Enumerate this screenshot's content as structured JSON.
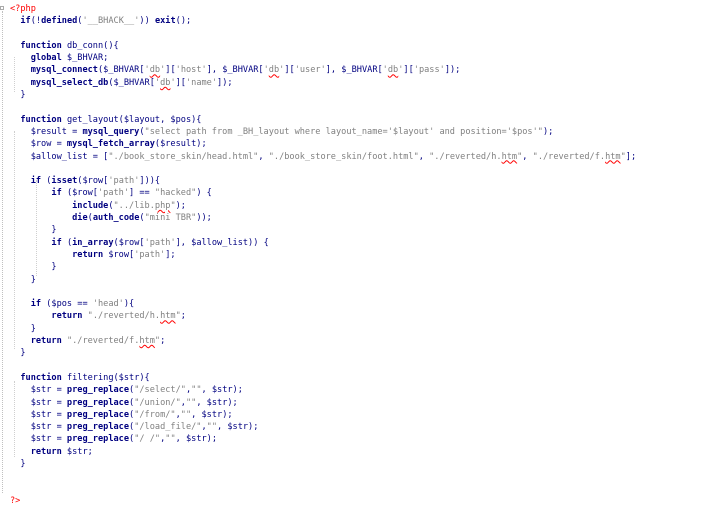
{
  "editor": {
    "lines": [
      [
        {
          "t": "<?php",
          "c": "tag"
        }
      ],
      [
        {
          "t": "  if(!defined("
        },
        {
          "t": "'__BHACK__'",
          "c": "str"
        },
        {
          "t": ")) exit();"
        }
      ],
      [],
      [
        {
          "t": "  function db_conn(){"
        }
      ],
      [
        {
          "t": "    global $_BHVAR;"
        }
      ],
      [
        {
          "t": "    mysql_connect($_BHVAR["
        },
        {
          "t": "'",
          "c": "str"
        },
        {
          "t": "db",
          "c": "str sq"
        },
        {
          "t": "'",
          "c": "str"
        },
        {
          "t": "]["
        },
        {
          "t": "'host'",
          "c": "str"
        },
        {
          "t": "], $_BHVAR["
        },
        {
          "t": "'",
          "c": "str"
        },
        {
          "t": "db",
          "c": "str sq"
        },
        {
          "t": "'",
          "c": "str"
        },
        {
          "t": "]["
        },
        {
          "t": "'user'",
          "c": "str"
        },
        {
          "t": "], $_BHVAR["
        },
        {
          "t": "'",
          "c": "str"
        },
        {
          "t": "db",
          "c": "str sq"
        },
        {
          "t": "'",
          "c": "str"
        },
        {
          "t": "]["
        },
        {
          "t": "'pass'",
          "c": "str"
        },
        {
          "t": "]);"
        }
      ],
      [
        {
          "t": "    mysql_select_db($_BHVAR["
        },
        {
          "t": "'",
          "c": "str"
        },
        {
          "t": "db",
          "c": "str sq"
        },
        {
          "t": "'",
          "c": "str"
        },
        {
          "t": "]["
        },
        {
          "t": "'name'",
          "c": "str"
        },
        {
          "t": "]);"
        }
      ],
      [
        {
          "t": "  }"
        }
      ],
      [],
      [
        {
          "t": "  function get_layout($layout, $pos){"
        }
      ],
      [
        {
          "t": "    $result = mysql_query("
        },
        {
          "t": "\"select path from _BH_layout where layout_name='$layout' and position='$pos'\"",
          "c": "str"
        },
        {
          "t": ");"
        }
      ],
      [
        {
          "t": "    $row = mysql_fetch_array($result);"
        }
      ],
      [
        {
          "t": "    $allow_list = ["
        },
        {
          "t": "\"./book_store_skin/head.html\"",
          "c": "str"
        },
        {
          "t": ", "
        },
        {
          "t": "\"./book_store_skin/foot.html\"",
          "c": "str"
        },
        {
          "t": ", "
        },
        {
          "t": "\"./reverted/h.",
          "c": "str"
        },
        {
          "t": "htm",
          "c": "str sq"
        },
        {
          "t": "\"",
          "c": "str"
        },
        {
          "t": ", "
        },
        {
          "t": "\"./reverted/f.",
          "c": "str"
        },
        {
          "t": "htm",
          "c": "str sq"
        },
        {
          "t": "\"",
          "c": "str"
        },
        {
          "t": "];"
        }
      ],
      [],
      [
        {
          "t": "    if (isset($row["
        },
        {
          "t": "'path'",
          "c": "str"
        },
        {
          "t": "])){"
        }
      ],
      [
        {
          "t": "        if ($row["
        },
        {
          "t": "'path'",
          "c": "str"
        },
        {
          "t": "] == "
        },
        {
          "t": "\"hacked\"",
          "c": "str"
        },
        {
          "t": ") {"
        }
      ],
      [
        {
          "t": "            include("
        },
        {
          "t": "\"../lib.",
          "c": "str"
        },
        {
          "t": "php",
          "c": "str sq"
        },
        {
          "t": "\"",
          "c": "str"
        },
        {
          "t": ");"
        }
      ],
      [
        {
          "t": "            die(auth_code("
        },
        {
          "t": "\"mini TBR\"",
          "c": "str"
        },
        {
          "t": "));"
        }
      ],
      [
        {
          "t": "        }"
        }
      ],
      [
        {
          "t": "        if (in_array($row["
        },
        {
          "t": "'path'",
          "c": "str"
        },
        {
          "t": "], $allow_list)) {"
        }
      ],
      [
        {
          "t": "            return $row["
        },
        {
          "t": "'path'",
          "c": "str"
        },
        {
          "t": "];"
        }
      ],
      [
        {
          "t": "        }"
        }
      ],
      [
        {
          "t": "    }"
        }
      ],
      [],
      [
        {
          "t": "    if ($pos == "
        },
        {
          "t": "'head'",
          "c": "str"
        },
        {
          "t": "){"
        }
      ],
      [
        {
          "t": "        return "
        },
        {
          "t": "\"./reverted/h.",
          "c": "str"
        },
        {
          "t": "htm",
          "c": "str sq"
        },
        {
          "t": "\"",
          "c": "str"
        },
        {
          "t": ";"
        }
      ],
      [
        {
          "t": "    }"
        }
      ],
      [
        {
          "t": "    return "
        },
        {
          "t": "\"./reverted/f.",
          "c": "str"
        },
        {
          "t": "htm",
          "c": "str sq"
        },
        {
          "t": "\"",
          "c": "str"
        },
        {
          "t": ";"
        }
      ],
      [
        {
          "t": "  }"
        }
      ],
      [],
      [
        {
          "t": "  function filtering($str){"
        }
      ],
      [
        {
          "t": "    $str = preg_replace("
        },
        {
          "t": "\"/select/\"",
          "c": "str"
        },
        {
          "t": ","
        },
        {
          "t": "\"\"",
          "c": "str"
        },
        {
          "t": ", $str);"
        }
      ],
      [
        {
          "t": "    $str = preg_replace("
        },
        {
          "t": "\"/union/\"",
          "c": "str"
        },
        {
          "t": ","
        },
        {
          "t": "\"\"",
          "c": "str"
        },
        {
          "t": ", $str);"
        }
      ],
      [
        {
          "t": "    $str = preg_replace("
        },
        {
          "t": "\"/from/\"",
          "c": "str"
        },
        {
          "t": ","
        },
        {
          "t": "\"\"",
          "c": "str"
        },
        {
          "t": ", $str);"
        }
      ],
      [
        {
          "t": "    $str = preg_replace("
        },
        {
          "t": "\"/load_file/\"",
          "c": "str"
        },
        {
          "t": ","
        },
        {
          "t": "\"\"",
          "c": "str"
        },
        {
          "t": ", $str);"
        }
      ],
      [
        {
          "t": "    $str = preg_replace("
        },
        {
          "t": "\"/ /\"",
          "c": "str"
        },
        {
          "t": ","
        },
        {
          "t": "\"\"",
          "c": "str"
        },
        {
          "t": ", $str);"
        }
      ],
      [
        {
          "t": "    return $str;"
        }
      ],
      [
        {
          "t": "  }"
        }
      ],
      [],
      [],
      [
        {
          "t": "?>",
          "c": "tag"
        }
      ]
    ]
  }
}
